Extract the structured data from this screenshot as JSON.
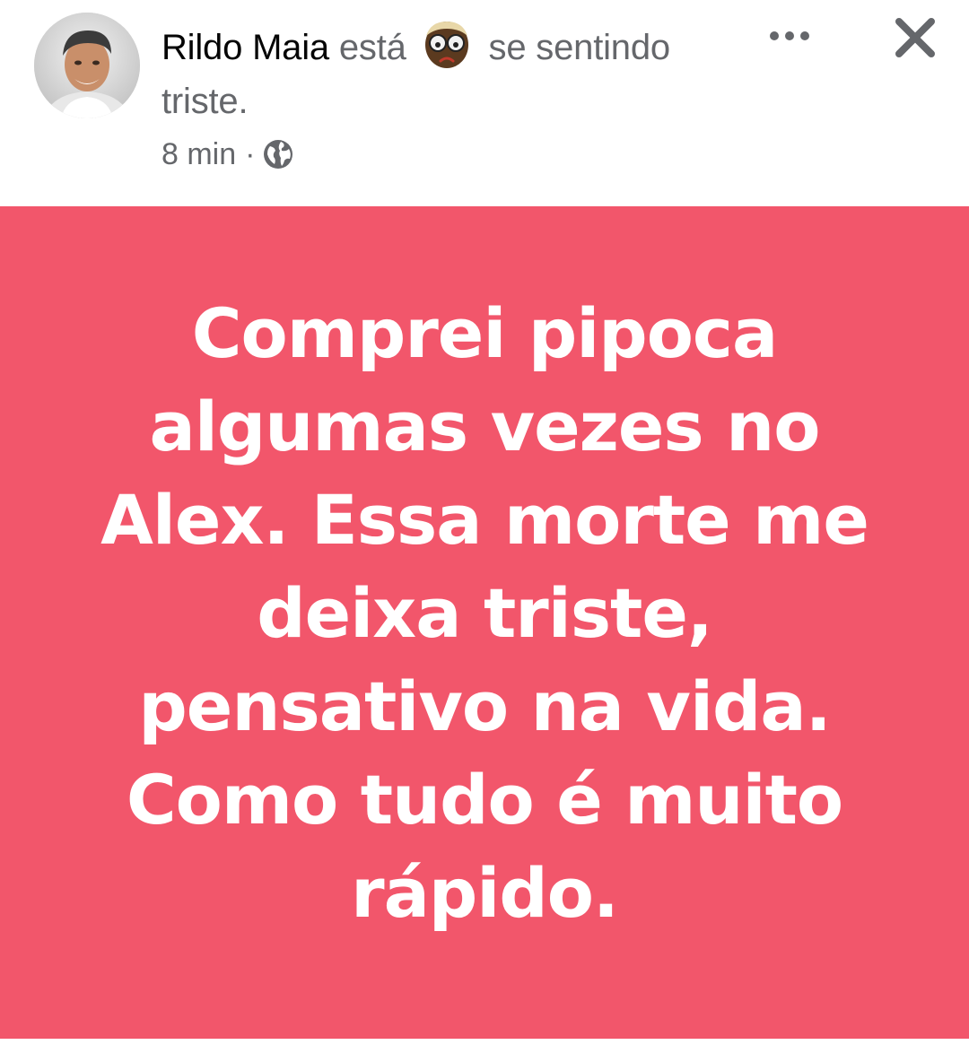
{
  "post": {
    "author": {
      "name": "Rildo Maia",
      "avatar_icon": "profile-photo"
    },
    "feeling": {
      "prefix": "está",
      "emoji_icon": "sad-face-emoji-with-glasses",
      "text": "se sentindo",
      "feeling_word": "triste."
    },
    "meta": {
      "time": "8 min",
      "separator": "·",
      "privacy_icon": "globe-icon"
    },
    "actions": {
      "more_icon": "more-options-icon",
      "close_icon": "close-icon"
    },
    "body": {
      "text": "Comprei pipoca algumas vezes no Alex. Essa morte me deixa triste, pensativo na vida. Como tudo é muito rápido.",
      "background_color": "#f2566b",
      "text_color": "#ffffff"
    }
  }
}
